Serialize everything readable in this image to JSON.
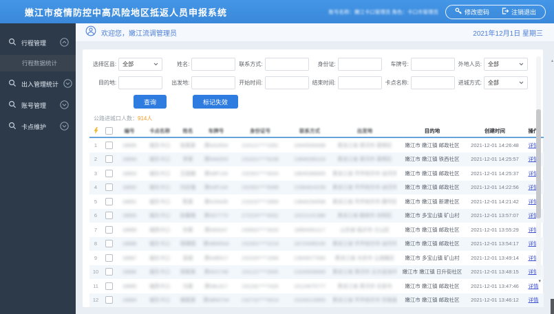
{
  "header": {
    "title": "嫩江市疫情防控中高风险地区抵返人员申报系统",
    "account_info": "账号名称：嫩江卡口管理员  角色：卡口市管理员",
    "change_password": "修改密码",
    "logout": "注销退出"
  },
  "sidebar": {
    "items": [
      {
        "id": "trip-management",
        "label": "行程管理",
        "expanded": true,
        "children": [
          {
            "id": "trip-data-statistics",
            "label": "行程数据统计",
            "active": true
          }
        ]
      },
      {
        "id": "access-statistics",
        "label": "出入管理统计",
        "expanded": false
      },
      {
        "id": "account-management",
        "label": "账号管理",
        "expanded": false
      },
      {
        "id": "checkpoint-maintenance",
        "label": "卡点维护",
        "expanded": false
      }
    ]
  },
  "welcome": {
    "text": "欢迎您，嫩江流调管理员",
    "date": "2021年12月1日 星期三"
  },
  "filters": {
    "rows": [
      [
        {
          "id": "district",
          "label": "选择区县:",
          "type": "select",
          "value": "全部"
        },
        {
          "id": "name",
          "label": "姓名:",
          "type": "input",
          "value": "",
          "placeholder": ""
        },
        {
          "id": "contact",
          "label": "联系方式:",
          "type": "input",
          "value": "",
          "placeholder": ""
        },
        {
          "id": "idcard",
          "label": "身份证:",
          "type": "input",
          "value": "",
          "placeholder": ""
        },
        {
          "id": "plate",
          "label": "车牌号:",
          "type": "input",
          "value": "",
          "placeholder": ""
        },
        {
          "id": "outsider",
          "label": "外地人员:",
          "type": "select",
          "value": "全部"
        }
      ],
      [
        {
          "id": "destination",
          "label": "目的地:",
          "type": "input",
          "value": "",
          "placeholder": ""
        },
        {
          "id": "origin",
          "label": "出发地:",
          "type": "input",
          "value": "",
          "placeholder": ""
        },
        {
          "id": "start-time",
          "label": "开始时间:",
          "type": "input",
          "value": "",
          "placeholder": ""
        },
        {
          "id": "end-time",
          "label": "结束时间:",
          "type": "input",
          "value": "",
          "placeholder": ""
        },
        {
          "id": "checkpoint",
          "label": "卡点名称:",
          "type": "input",
          "value": "",
          "placeholder": ""
        },
        {
          "id": "entry-method",
          "label": "进城方式:",
          "type": "select",
          "value": "全部"
        }
      ]
    ]
  },
  "actions": {
    "search": "查询",
    "mark_invalid": "标记失效"
  },
  "summary": {
    "label": "公路进城口人数：",
    "count": "914人"
  },
  "table": {
    "action_label": "详情",
    "columns": [
      {
        "key": "flash",
        "label": "",
        "width": 16,
        "masked": false
      },
      {
        "key": "select",
        "label": "",
        "width": 18,
        "masked": false
      },
      {
        "key": "serial",
        "label": "编号",
        "width": 38,
        "masked": true
      },
      {
        "key": "checkpoint",
        "label": "卡点名称",
        "width": 46,
        "masked": true
      },
      {
        "key": "name",
        "label": "姓名",
        "width": 32,
        "masked": true
      },
      {
        "key": "plate",
        "label": "车牌号",
        "width": 46,
        "masked": true
      },
      {
        "key": "idcard",
        "label": "身份证号",
        "width": 78,
        "masked": true
      },
      {
        "key": "contact",
        "label": "联系方式",
        "width": 62,
        "masked": true
      },
      {
        "key": "origin",
        "label": "出发地",
        "width": 94,
        "masked": true
      },
      {
        "key": "destination",
        "label": "目的地",
        "width": 98,
        "masked": false
      },
      {
        "key": "created",
        "label": "创建时间",
        "width": 80,
        "masked": false
      },
      {
        "key": "action",
        "label": "操作",
        "width": 28,
        "masked": false
      }
    ],
    "rows": [
      {
        "serial": "18895",
        "checkpoint": "城东卡口",
        "name": "张某某",
        "plate": "黑NA2654",
        "idcard": "210121****1081",
        "contact": "18445084088",
        "origin": "黑龙江省 黑河市 爱辉区",
        "destination": "嫩江市 嫩江镇 邮政社区",
        "created": "2021-12-01 14:26:48"
      },
      {
        "serial": "18894",
        "checkpoint": "城东卡口",
        "name": "李某",
        "plate": "黑NA6303",
        "idcard": "231021****5238",
        "contact": "13846395119",
        "origin": "黑龙江省 黑河市 爱辉区",
        "destination": "嫩江市 嫩江镇 铁西社区",
        "created": "2021-12-01 14:25:57"
      },
      {
        "serial": "18893",
        "checkpoint": "城北卡口",
        "name": "王丽娟",
        "plate": "黑N8F144",
        "idcard": "232301****4043",
        "contact": "18645386665",
        "origin": "黑龙江省 齐齐哈尔市 讷河市",
        "destination": "嫩江市 嫩江镇 邮政社区",
        "created": "2021-12-01 14:25:37"
      },
      {
        "serial": "18892",
        "checkpoint": "城北卡口",
        "name": "刘志强",
        "plate": "黑N3F144",
        "idcard": "232301****5089",
        "contact": "13384624239",
        "origin": "黑龙江省 齐齐哈尔市 讷河市",
        "destination": "嫩江市 嫩江镇 邮政社区",
        "created": "2021-12-01 14:22:56"
      },
      {
        "serial": "18891",
        "checkpoint": "城东卡口",
        "name": "陈某",
        "plate": "黑NJN435",
        "idcard": "210222****2869",
        "contact": "13846294568",
        "origin": "黑龙江省 齐齐哈尔市 建华区",
        "destination": "嫩江市 嫩江镇 新建社区",
        "created": "2021-12-01 14:21:42"
      },
      {
        "serial": "18890",
        "checkpoint": "城北卡口",
        "name": "赵春梅",
        "plate": "黑ND7770",
        "idcard": "272224****4052",
        "contact": "15221141388",
        "origin": "黑龙江省 鹤岗市 向阳区",
        "destination": "嫩江市 多宝山镇 矿山村",
        "created": "2021-12-01 13:57:07"
      },
      {
        "serial": "18889",
        "checkpoint": "城西卡口",
        "name": "孙某",
        "plate": "黑N69247",
        "idcard": "230602****2620",
        "contact": "18804061117",
        "origin": "山东省 临沂市 兰山区",
        "destination": "嫩江市 嫩江镇 邮政社区",
        "created": "2021-12-01 13:55:29"
      },
      {
        "serial": "18888",
        "checkpoint": "城东卡口",
        "name": "周建国",
        "plate": "黑NBW544",
        "idcard": "232301****2219",
        "contact": "18724495245",
        "origin": "黑龙江省 齐齐哈尔市 讷河市",
        "destination": "嫩江市 嫩江镇 邮政社区",
        "created": "2021-12-01 13:54:17"
      },
      {
        "serial": "18887",
        "checkpoint": "城北卡口",
        "name": "吴丽",
        "plate": "黑N4B517",
        "idcard": "231025****1994",
        "contact": "13945077560",
        "origin": "黑龙江省 大庆市 让胡路区",
        "destination": "嫩江市 多宝山镇 矿山村",
        "created": "2021-12-01 13:49:14"
      },
      {
        "serial": "18886",
        "checkpoint": "城东卡口",
        "name": "郑某某",
        "plate": "黑ND2748",
        "idcard": "231121****2845",
        "contact": "13245636666",
        "origin": "黑龙江省 黑河市 五大连池市",
        "destination": "嫩江市 嫩江镇 日升街社区",
        "created": "2021-12-01 13:48:15"
      },
      {
        "serial": "18885",
        "checkpoint": "城西卡口",
        "name": "冯某",
        "plate": "黑N8L817",
        "idcard": "231181****7426",
        "contact": "15124675777",
        "origin": "黑龙江省 黑河市 北安市",
        "destination": "嫩江市 嫩江镇 邮政社区",
        "created": "2021-12-01 13:47:46"
      },
      {
        "serial": "18884",
        "checkpoint": "城东卡口",
        "name": "褚某某",
        "plate": "黑NBW744",
        "idcard": "232722****9314",
        "contact": "15245219955",
        "origin": "黑龙江省 齐齐哈尔市 甘南县",
        "destination": "嫩江市 嫩江镇 邮政社区",
        "created": "2021-12-01 13:46:12"
      }
    ]
  },
  "colors": {
    "header_bg": "#3D8EE0",
    "sidebar_bg": "#2D3A49",
    "button_bg": "#2E7CE0",
    "link": "#3D4FD0",
    "count_highlight": "#F59A23",
    "welcome_text": "#4D7FD6",
    "row_stripe": "#F2F7FC"
  }
}
